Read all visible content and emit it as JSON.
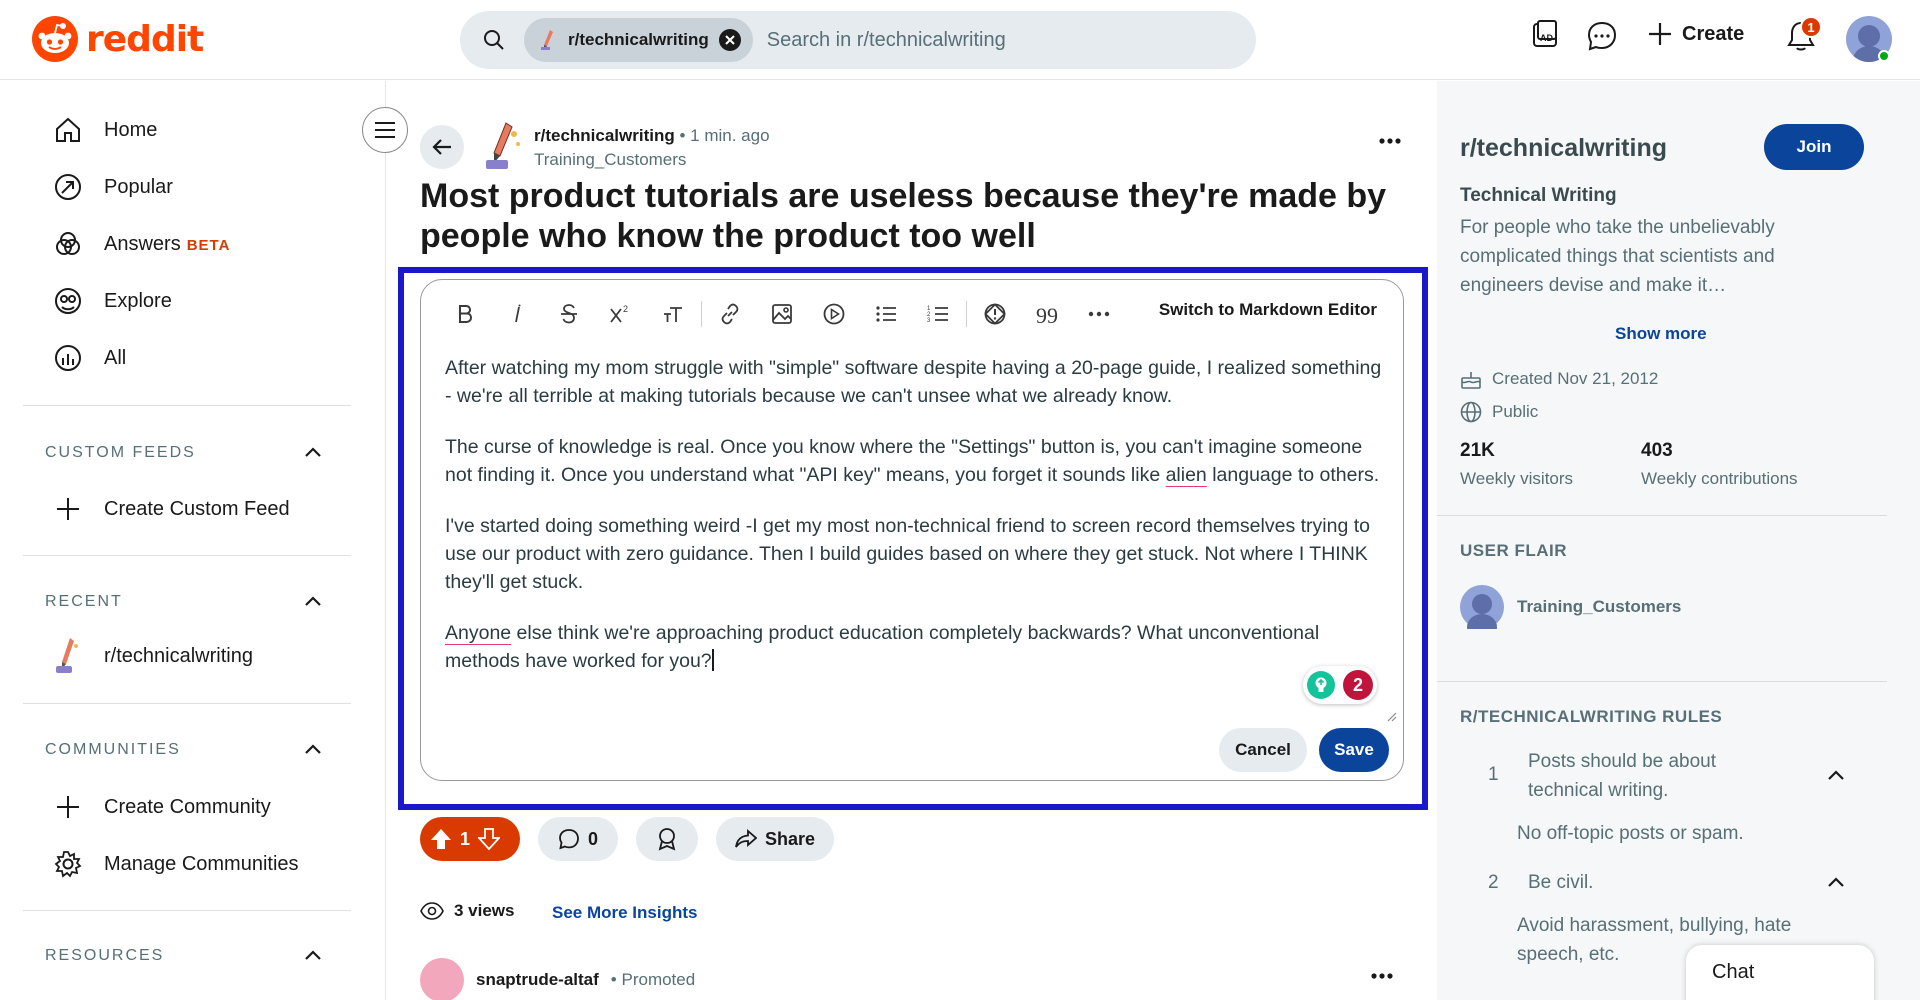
{
  "header": {
    "logo_text": "reddit",
    "search_chip": "r/technicalwriting",
    "search_placeholder": "Search in r/technicalwriting",
    "create_label": "Create",
    "notification_count": "1"
  },
  "nav": {
    "items": [
      {
        "label": "Home",
        "icon": "home-icon"
      },
      {
        "label": "Popular",
        "icon": "popular-icon"
      },
      {
        "label": "Answers",
        "icon": "answers-icon",
        "badge": "BETA"
      },
      {
        "label": "Explore",
        "icon": "explore-icon"
      },
      {
        "label": "All",
        "icon": "all-icon"
      }
    ],
    "custom_feeds": {
      "title": "CUSTOM FEEDS",
      "create": "Create Custom Feed"
    },
    "recent": {
      "title": "RECENT",
      "item": "r/technicalwriting"
    },
    "communities": {
      "title": "COMMUNITIES",
      "create": "Create Community",
      "manage": "Manage Communities"
    },
    "resources": {
      "title": "RESOURCES"
    }
  },
  "post": {
    "subreddit": "r/technicalwriting",
    "time": "• 1 min. ago",
    "author": "Training_Customers",
    "title": "Most product tutorials are useless because they're made by people who know the product too well",
    "editor": {
      "markdown_switch": "Switch to Markdown Editor",
      "p1": "After watching my mom struggle with \"simple\" software despite having a 20-page guide, I realized something - we're all terrible at making tutorials because we can't unsee what we already know.",
      "p2_before": "The curse of knowledge is real. Once you know where the \"Settings\" button is, you can't imagine someone not finding it. Once you understand what \"API key\" means, you forget it sounds like ",
      "p2_flag": "alien",
      "p2_after": " language to others.",
      "p3": "I've started doing something weird -I get my most non-technical friend to screen record themselves trying to use our product with zero guidance. Then I build guides based on where they get stuck. Not where I THINK they'll get stuck.",
      "p4_flag": "Anyone",
      "p4_after": " else think we're approaching product education completely backwards? What unconventional methods have worked for you?",
      "grammar_count": "2",
      "cancel": "Cancel",
      "save": "Save"
    },
    "votes": "1",
    "comments": "0",
    "share": "Share",
    "views": "3 views",
    "insights": "See More Insights",
    "promo_name": "snaptrude-altaf",
    "promo_tag": "Promoted"
  },
  "sidebar": {
    "title": "r/technicalwriting",
    "join": "Join",
    "subtitle": "Technical Writing",
    "description": "For people who take the unbelievably complicated things that scientists and engineers devise and make it…",
    "show_more": "Show more",
    "created": "Created Nov 21, 2012",
    "visibility": "Public",
    "stat1_num": "21K",
    "stat1_label": "Weekly visitors",
    "stat2_num": "403",
    "stat2_label": "Weekly contributions",
    "flair_title": "USER FLAIR",
    "flair_name": "Training_Customers",
    "rules_title": "R/TECHNICALWRITING RULES",
    "rules": [
      {
        "num": "1",
        "text": "Posts should be about technical writing.",
        "desc": "No off-topic posts or spam."
      },
      {
        "num": "2",
        "text": "Be civil.",
        "desc": "Avoid harassment, bullying, hate speech, etc."
      }
    ],
    "chat": "Chat"
  }
}
